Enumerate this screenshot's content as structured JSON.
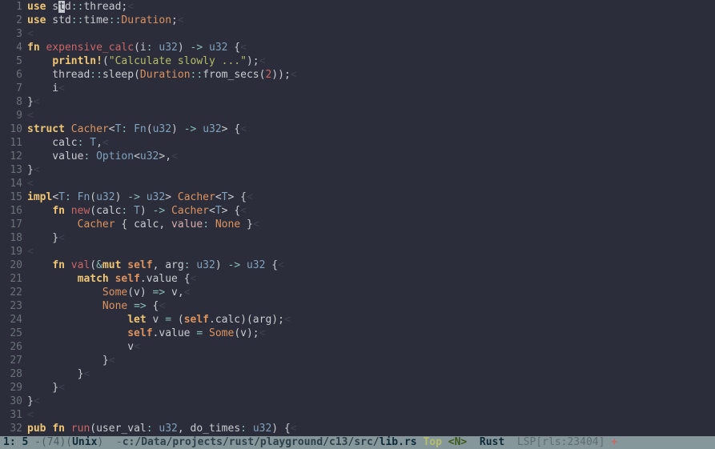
{
  "editor": {
    "lines": [
      {
        "n": 1,
        "html": "<span class='k'>use</span> s<span class='cursor'>t</span>d<span class='op'>::</span>thread;<span class='eol'>&lt;</span>"
      },
      {
        "n": 2,
        "html": "<span class='k'>use</span> std<span class='op'>::</span>time<span class='op'>::</span><span class='tyc'>Duration</span>;<span class='eol'>&lt;</span>"
      },
      {
        "n": 3,
        "html": "<span class='eol'>&lt;</span>"
      },
      {
        "n": 4,
        "html": "<span class='k'>fn</span> <span class='fnname'>expensive_calc</span>(i<span class='op'>:</span> <span class='ty'>u32</span>) <span class='arr'>-&gt;</span> <span class='ty'>u32</span> {<span class='eol'>&lt;</span>"
      },
      {
        "n": 5,
        "html": "    <span class='macro'>println!</span>(<span class='str'>\"Calculate slowly ...\"</span>);<span class='eol'>&lt;</span>"
      },
      {
        "n": 6,
        "html": "    thread<span class='op'>::</span>sleep(<span class='tyc'>Duration</span><span class='op'>::</span>from_secs(<span class='num'>2</span>));<span class='eol'>&lt;</span>"
      },
      {
        "n": 7,
        "html": "    i<span class='eol'>&lt;</span>"
      },
      {
        "n": 8,
        "html": "}<span class='eol'>&lt;</span>"
      },
      {
        "n": 9,
        "html": "<span class='eol'>&lt;</span>"
      },
      {
        "n": 10,
        "html": "<span class='k'>struct</span> <span class='tyc'>Cacher</span>&lt;<span class='ty'>T</span><span class='op'>:</span> <span class='ty'>Fn</span>(<span class='ty'>u32</span>) <span class='arr'>-&gt;</span> <span class='ty'>u32</span>&gt; {<span class='eol'>&lt;</span>"
      },
      {
        "n": 11,
        "html": "    calc<span class='op'>:</span> <span class='ty'>T</span>,<span class='eol'>&lt;</span>"
      },
      {
        "n": 12,
        "html": "    value<span class='op'>:</span> <span class='ty'>Option</span>&lt;<span class='ty'>u32</span>&gt;,<span class='eol'>&lt;</span>"
      },
      {
        "n": 13,
        "html": "}<span class='eol'>&lt;</span>"
      },
      {
        "n": 14,
        "html": "<span class='eol'>&lt;</span>"
      },
      {
        "n": 15,
        "html": "<span class='k'>impl</span>&lt;<span class='ty'>T</span><span class='op'>:</span> <span class='ty'>Fn</span>(<span class='ty'>u32</span>) <span class='arr'>-&gt;</span> <span class='ty'>u32</span>&gt; <span class='tyc'>Cacher</span>&lt;<span class='ty'>T</span>&gt; {<span class='eol'>&lt;</span>"
      },
      {
        "n": 16,
        "html": "    <span class='k'>fn</span> <span class='fnname'>new</span>(calc<span class='op'>:</span> <span class='ty'>T</span>) <span class='arr'>-&gt;</span> <span class='tyc'>Cacher</span>&lt;<span class='ty'>T</span>&gt; {<span class='eol'>&lt;</span>"
      },
      {
        "n": 17,
        "html": "        <span class='tyc'>Cacher</span> { calc, <span class='fld'>value</span><span class='op'>:</span> <span class='none'>None</span> }<span class='eol'>&lt;</span>"
      },
      {
        "n": 18,
        "html": "    }<span class='eol'>&lt;</span>"
      },
      {
        "n": 19,
        "html": "<span class='eol'>&lt;</span>"
      },
      {
        "n": 20,
        "html": "    <span class='k'>fn</span> <span class='fnname'>val</span>(<span class='op'>&amp;</span><span class='k'>mut</span> <span class='self'>self</span>, arg<span class='op'>:</span> <span class='ty'>u32</span>) <span class='arr'>-&gt;</span> <span class='ty'>u32</span> {<span class='eol'>&lt;</span>"
      },
      {
        "n": 21,
        "html": "        <span class='k'>match</span> <span class='self'>self</span>.value {<span class='eol'>&lt;</span>"
      },
      {
        "n": 22,
        "html": "            <span class='none'>Some</span>(v) <span class='arr'>=&gt;</span> v,<span class='eol'>&lt;</span>"
      },
      {
        "n": 23,
        "html": "            <span class='none'>None</span> <span class='arr'>=&gt;</span> {<span class='eol'>&lt;</span>"
      },
      {
        "n": 24,
        "html": "                <span class='k'>let</span> v <span class='op'>=</span> (<span class='self'>self</span>.calc)(arg);<span class='eol'>&lt;</span>"
      },
      {
        "n": 25,
        "html": "                <span class='self'>self</span>.value <span class='op'>=</span> <span class='none'>Some</span>(v);<span class='eol'>&lt;</span>"
      },
      {
        "n": 26,
        "html": "                v<span class='eol'>&lt;</span>"
      },
      {
        "n": 27,
        "html": "            }<span class='eol'>&lt;</span>"
      },
      {
        "n": 28,
        "html": "        }<span class='eol'>&lt;</span>"
      },
      {
        "n": 29,
        "html": "    }<span class='eol'>&lt;</span>"
      },
      {
        "n": 30,
        "html": "}<span class='eol'>&lt;</span>"
      },
      {
        "n": 31,
        "html": "<span class='eol'>&lt;</span>"
      },
      {
        "n": 32,
        "html": "<span class='k'>pub</span> <span class='k'>fn</span> <span class='fnname'>run</span>(user_val<span class='op'>:</span> <span class='ty'>u32</span>, do_times<span class='op'>:</span> <span class='ty'>u32</span>) {<span class='eol'>&lt;</span>"
      }
    ]
  },
  "status": {
    "pos": "1: 5 ",
    "changes": "-(74)",
    "open": "(",
    "encoding": "Unix",
    "close": ") ",
    "sep": " -",
    "path": "c:/Data/projects/rust/playground/c13/src/",
    "file": "lib.rs",
    "space1": " ",
    "top": "Top",
    "space2": " ",
    "mode": "<N>",
    "space3": "  ",
    "lang": "Rust",
    "space4": "  ",
    "lsp": "LSP[rls:23404]",
    "space5": " ",
    "plus": "+"
  }
}
